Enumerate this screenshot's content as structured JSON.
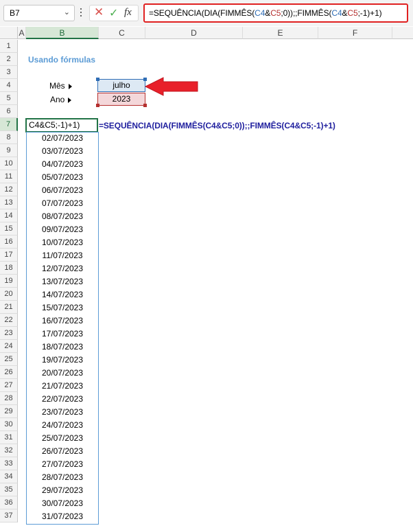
{
  "formula_bar": {
    "name_box": "B7",
    "formula_prefix": "=SEQUÊNCIA(DIA(FIMMÊS(",
    "ref1": "C4",
    "amp1": "&",
    "ref2": "C5",
    "mid": ";0));;FIMMÊS(",
    "ref3": "C4",
    "amp2": "&",
    "ref4": "C5",
    "suffix": ";-1)+1)",
    "fx_label": "fx"
  },
  "columns": [
    {
      "label": "A",
      "selected": false
    },
    {
      "label": "B",
      "selected": true
    },
    {
      "label": "C",
      "selected": false
    },
    {
      "label": "D",
      "selected": false
    },
    {
      "label": "E",
      "selected": false
    },
    {
      "label": "F",
      "selected": false
    }
  ],
  "rows": [
    "1",
    "2",
    "3",
    "4",
    "5",
    "6",
    "7",
    "8",
    "9",
    "10",
    "11",
    "12",
    "13",
    "14",
    "15",
    "16",
    "17",
    "18",
    "19",
    "20",
    "21",
    "22",
    "23",
    "24",
    "25",
    "26",
    "27",
    "28",
    "29",
    "30",
    "31",
    "32",
    "33",
    "34",
    "35",
    "36",
    "37"
  ],
  "sheet": {
    "title": "Usando fórmulas",
    "mes_label": "Mês",
    "ano_label": "Ano",
    "mes_value": "julho",
    "ano_value": "2023",
    "active_cell_text": "C4&C5;-1)+1)",
    "editing_formula": "=SEQUÊNCIA(DIA(FIMMÊS(C4&C5;0));;FIMMÊS(C4&C5;-1)+1)",
    "dates": [
      "02/07/2023",
      "03/07/2023",
      "04/07/2023",
      "05/07/2023",
      "06/07/2023",
      "07/07/2023",
      "08/07/2023",
      "09/07/2023",
      "10/07/2023",
      "11/07/2023",
      "12/07/2023",
      "13/07/2023",
      "14/07/2023",
      "15/07/2023",
      "16/07/2023",
      "17/07/2023",
      "18/07/2023",
      "19/07/2023",
      "20/07/2023",
      "21/07/2023",
      "22/07/2023",
      "23/07/2023",
      "24/07/2023",
      "25/07/2023",
      "26/07/2023",
      "27/07/2023",
      "28/07/2023",
      "29/07/2023",
      "30/07/2023",
      "31/07/2023"
    ]
  },
  "colors": {
    "accent_green": "#217346",
    "ref_blue": "#2f6db5",
    "ref_red": "#b5302f",
    "arrow_red": "#e8202a",
    "title_blue": "#5b9bd5"
  }
}
